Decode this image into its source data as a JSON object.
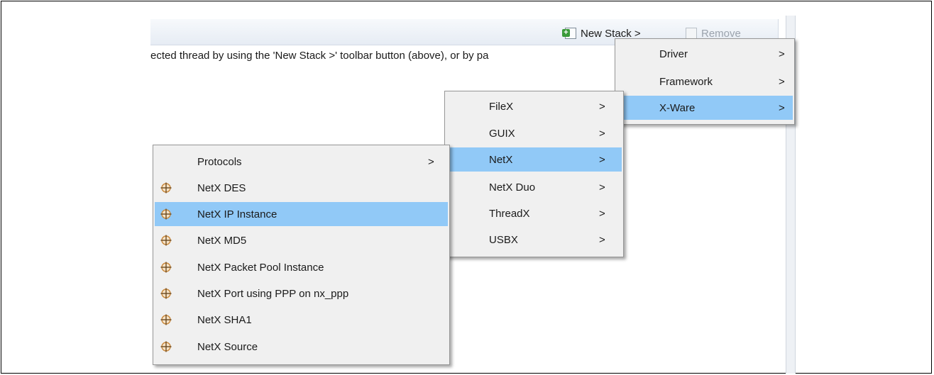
{
  "toolbar": {
    "new_stack_label": "New Stack >",
    "remove_label": "Remove"
  },
  "info_text": "ected thread by using the 'New Stack >' toolbar button (above), or by pa",
  "menu_categories": {
    "items": [
      {
        "label": "Driver",
        "arrow": ">",
        "highlighted": false
      },
      {
        "label": "Framework",
        "arrow": ">",
        "highlighted": false
      },
      {
        "label": "X-Ware",
        "arrow": ">",
        "highlighted": true
      }
    ]
  },
  "menu_xware": {
    "items": [
      {
        "label": "FileX",
        "arrow": ">",
        "highlighted": false
      },
      {
        "label": "GUIX",
        "arrow": ">",
        "highlighted": false
      },
      {
        "label": "NetX",
        "arrow": ">",
        "highlighted": true
      },
      {
        "label": "NetX Duo",
        "arrow": ">",
        "highlighted": false
      },
      {
        "label": "ThreadX",
        "arrow": ">",
        "highlighted": false
      },
      {
        "label": "USBX",
        "arrow": ">",
        "highlighted": false
      }
    ]
  },
  "menu_netx": {
    "items": [
      {
        "label": "Protocols",
        "arrow": ">",
        "icon": "",
        "highlighted": false
      },
      {
        "label": "NetX DES",
        "arrow": "",
        "icon": "module-crosshair-icon",
        "highlighted": false
      },
      {
        "label": "NetX IP Instance",
        "arrow": "",
        "icon": "module-crosshair-icon",
        "highlighted": true
      },
      {
        "label": "NetX MD5",
        "arrow": "",
        "icon": "module-crosshair-icon",
        "highlighted": false
      },
      {
        "label": "NetX Packet Pool Instance",
        "arrow": "",
        "icon": "module-crosshair-icon",
        "highlighted": false
      },
      {
        "label": "NetX Port using PPP on nx_ppp",
        "arrow": "",
        "icon": "module-crosshair-icon",
        "highlighted": false
      },
      {
        "label": "NetX SHA1",
        "arrow": "",
        "icon": "module-crosshair-icon",
        "highlighted": false
      },
      {
        "label": "NetX Source",
        "arrow": "",
        "icon": "module-crosshair-icon",
        "highlighted": false
      }
    ]
  },
  "colors": {
    "highlight": "#91c9f7",
    "menu_background": "#f0f0f0",
    "icon_accent": "#c8873a"
  }
}
